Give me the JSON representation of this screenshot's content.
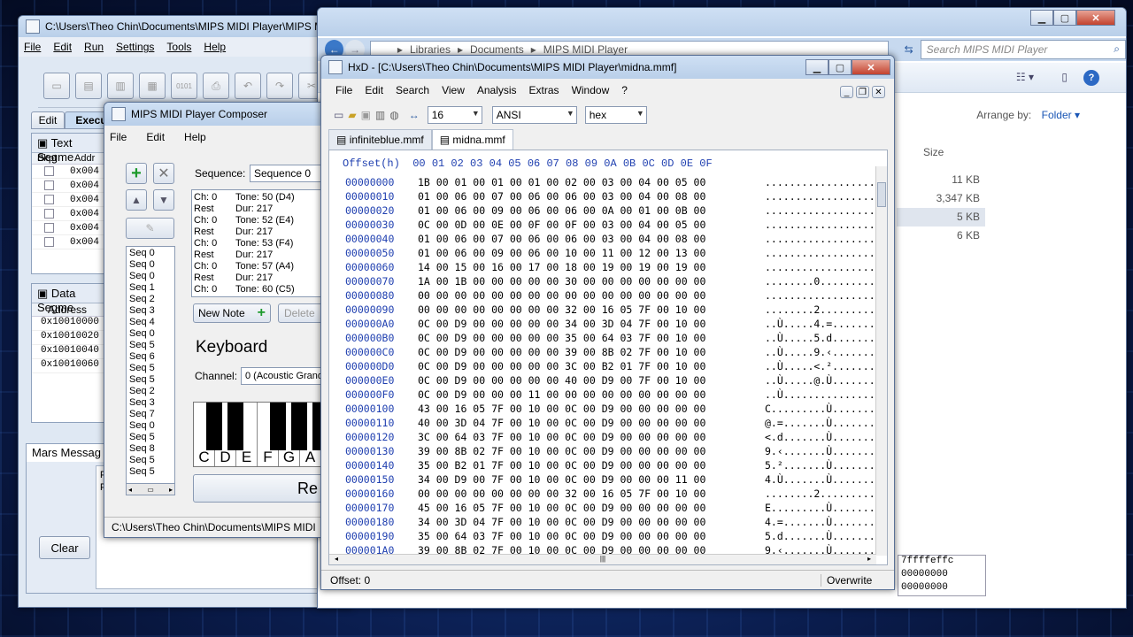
{
  "mars": {
    "title": "C:\\Users\\Theo Chin\\Documents\\MIPS MIDI Player\\MIPS MI",
    "menu": [
      "File",
      "Edit",
      "Run",
      "Settings",
      "Tools",
      "Help"
    ],
    "tabs": [
      "Edit",
      "Execu"
    ],
    "text_seg": "Text Segme",
    "text_cols": [
      "Bkpt",
      "Addr"
    ],
    "text_rows": [
      "0x004",
      "0x004",
      "0x004",
      "0x004",
      "0x004",
      "0x004"
    ],
    "data_seg": "Data Segme",
    "data_col": "Address",
    "data_rows": [
      "0x10010000",
      "0x10010020",
      "0x10010040",
      "0x10010060"
    ],
    "messages": "Mars Messag",
    "msg_lines": [
      "Pl",
      "Pl"
    ],
    "clear": "Clear",
    "right_vals": [
      "7ffffeffc",
      "00000000",
      "00000000"
    ]
  },
  "explorer": {
    "crumbs": [
      "Libraries",
      "Documents",
      "MIPS MIDI Player"
    ],
    "search": "Search MIPS MIDI Player",
    "arrange": "Arrange by:",
    "folder": "Folder",
    "size_col": "Size",
    "sizes": [
      "11 KB",
      "3,347 KB",
      "5 KB",
      "6 KB"
    ]
  },
  "composer": {
    "title": "MIPS MIDI Player Composer",
    "menu": [
      "File",
      "Edit",
      "Help"
    ],
    "sequence_label": "Sequence:",
    "sequence_value": "Sequence 0",
    "notes": [
      [
        "Ch: 0",
        "Tone: 50 (D4)"
      ],
      [
        "Rest",
        "Dur: 217"
      ],
      [
        "Ch: 0",
        "Tone: 52 (E4)"
      ],
      [
        "Rest",
        "Dur: 217"
      ],
      [
        "Ch: 0",
        "Tone: 53 (F4)"
      ],
      [
        "Rest",
        "Dur: 217"
      ],
      [
        "Ch: 0",
        "Tone: 57 (A4)"
      ],
      [
        "Rest",
        "Dur: 217"
      ],
      [
        "Ch: 0",
        "Tone: 60 (C5)"
      ]
    ],
    "seqs": [
      "Seq 0",
      "Seq 0",
      "Seq 0",
      "Seq 1",
      "Seq 2",
      "Seq 3",
      "Seq 4",
      "Seq 0",
      "Seq 5",
      "Seq 6",
      "Seq 5",
      "Seq 5",
      "Seq 2",
      "Seq 3",
      "Seq 7",
      "Seq 0",
      "Seq 5",
      "Seq 8",
      "Seq 5",
      "Seq 5"
    ],
    "new_note": "New Note",
    "delete": "Delete",
    "keyboard": "Keyboard",
    "channel_label": "Channel:",
    "channel_value": "0 (Acoustic Grand",
    "keys": [
      "C",
      "D",
      "E",
      "F",
      "G",
      "A"
    ],
    "record": "Re",
    "status": "C:\\Users\\Theo Chin\\Documents\\MIPS MIDI"
  },
  "hxd": {
    "title": "HxD - [C:\\Users\\Theo Chin\\Documents\\MIPS MIDI Player\\midna.mmf]",
    "menu": [
      "File",
      "Edit",
      "Search",
      "View",
      "Analysis",
      "Extras",
      "Window",
      "?"
    ],
    "cols": "16",
    "charset": "ANSI",
    "mode": "hex",
    "tabs": [
      "infiniteblue.mmf",
      "midna.mmf"
    ],
    "header": "Offset(h)  00 01 02 03 04 05 06 07 08 09 0A 0B 0C 0D 0E 0F",
    "rows": [
      [
        "00000000",
        "1B 00 01 00 01 00 01 00 02 00 03 00 04 00 05 00",
        ".................."
      ],
      [
        "00000010",
        "01 00 06 00 07 00 06 00 06 00 03 00 04 00 08 00",
        ".................."
      ],
      [
        "00000020",
        "01 00 06 00 09 00 06 00 06 00 0A 00 01 00 0B 00",
        ".................."
      ],
      [
        "00000030",
        "0C 00 0D 00 0E 00 0F 00 0F 00 03 00 04 00 05 00",
        ".................."
      ],
      [
        "00000040",
        "01 00 06 00 07 00 06 00 06 00 03 00 04 00 08 00",
        ".................."
      ],
      [
        "00000050",
        "01 00 06 00 09 00 06 00 10 00 11 00 12 00 13 00",
        ".................."
      ],
      [
        "00000060",
        "14 00 15 00 16 00 17 00 18 00 19 00 19 00 19 00",
        ".................."
      ],
      [
        "00000070",
        "1A 00 1B 00 00 00 00 00 30 00 00 00 00 00 00 00",
        "........0........."
      ],
      [
        "00000080",
        "00 00 00 00 00 00 00 00 00 00 00 00 00 00 00 00",
        ".................."
      ],
      [
        "00000090",
        "00 00 00 00 00 00 00 00 32 00 16 05 7F 00 10 00",
        "........2........."
      ],
      [
        "000000A0",
        "0C 00 D9 00 00 00 00 00 34 00 3D 04 7F 00 10 00",
        "..Ù.....4.=......."
      ],
      [
        "000000B0",
        "0C 00 D9 00 00 00 00 00 35 00 64 03 7F 00 10 00",
        "..Ù.....5.d......."
      ],
      [
        "000000C0",
        "0C 00 D9 00 00 00 00 00 39 00 8B 02 7F 00 10 00",
        "..Ù.....9.‹......."
      ],
      [
        "000000D0",
        "0C 00 D9 00 00 00 00 00 3C 00 B2 01 7F 00 10 00",
        "..Ù.....<.²......."
      ],
      [
        "000000E0",
        "0C 00 D9 00 00 00 00 00 40 00 D9 00 7F 00 10 00",
        "..Ù.....@.Ù......."
      ],
      [
        "000000F0",
        "0C 00 D9 00 00 00 11 00 00 00 00 00 00 00 00 00",
        "..Ù..............."
      ],
      [
        "00000100",
        "43 00 16 05 7F 00 10 00 0C 00 D9 00 00 00 00 00",
        "C.........Ù......."
      ],
      [
        "00000110",
        "40 00 3D 04 7F 00 10 00 0C 00 D9 00 00 00 00 00",
        "@.=.......Ù......."
      ],
      [
        "00000120",
        "3C 00 64 03 7F 00 10 00 0C 00 D9 00 00 00 00 00",
        "<.d.......Ù......."
      ],
      [
        "00000130",
        "39 00 8B 02 7F 00 10 00 0C 00 D9 00 00 00 00 00",
        "9.‹.......Ù......."
      ],
      [
        "00000140",
        "35 00 B2 01 7F 00 10 00 0C 00 D9 00 00 00 00 00",
        "5.².......Ù......."
      ],
      [
        "00000150",
        "34 00 D9 00 7F 00 10 00 0C 00 D9 00 00 00 11 00",
        "4.Ù.......Ù......."
      ],
      [
        "00000160",
        "00 00 00 00 00 00 00 00 32 00 16 05 7F 00 10 00",
        "........2........."
      ],
      [
        "00000170",
        "45 00 16 05 7F 00 10 00 0C 00 D9 00 00 00 00 00",
        "E.........Ù......."
      ],
      [
        "00000180",
        "34 00 3D 04 7F 00 10 00 0C 00 D9 00 00 00 00 00",
        "4.=.......Ù......."
      ],
      [
        "00000190",
        "35 00 64 03 7F 00 10 00 0C 00 D9 00 00 00 00 00",
        "5.d.......Ù......."
      ],
      [
        "000001A0",
        "39 00 8B 02 7F 00 10 00 0C 00 D9 00 00 00 00 00",
        "9.‹.......Ù......."
      ]
    ],
    "status_offset": "Offset: 0",
    "status_mode": "Overwrite"
  }
}
